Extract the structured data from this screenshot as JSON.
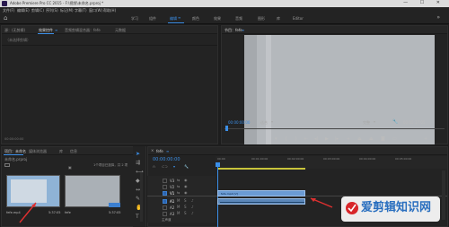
{
  "titlebar": {
    "title": "Adobe Premiere Pro CC 2015 - F:\\视频\\未命名.prproj *",
    "controls": "—  ☐  ✕"
  },
  "menu": [
    "文件(F)",
    "编辑(E)",
    "剪辑(C)",
    "序列(S)",
    "标记(M)",
    "字幕(T)",
    "窗口(W)",
    "帮助(H)"
  ],
  "workspaces": {
    "items": [
      "学习",
      "组件",
      "编辑",
      "颜色",
      "效果",
      "音频",
      "图形",
      "库"
    ],
    "active_index": 2,
    "extra": "Editor",
    "more": "»"
  },
  "source_panel": {
    "tabs": [
      "源：(无剪辑)",
      "效果控件",
      "音频剪辑混合器：fefe",
      "元数据"
    ],
    "active_tab": 1,
    "clip_label": "（未选择剪辑）",
    "timecode": "00:00:00:00"
  },
  "program_panel": {
    "tab": "节目：fefe",
    "timecode_left": "00:00:00:00",
    "fit_label": "适合",
    "quality_label": "完整",
    "timecode_right": "00:05:37:05"
  },
  "project_panel": {
    "tabs": [
      "项目：未命名",
      "媒体浏览器",
      "库",
      "信息"
    ],
    "path": "未命名.prproj",
    "item_count": "1个项目已选择，共 2 项",
    "items": [
      {
        "name": "fefe.mp4",
        "duration": "5:37:05"
      },
      {
        "name": "fefe",
        "duration": "5:37:05"
      }
    ],
    "colors": {
      "thumb1": "#8fb3d6",
      "thumb2": "#aab0b6"
    }
  },
  "timeline": {
    "tab": "fefe",
    "timecode": "00:00:00:00",
    "ruler": [
      "00:00",
      "00:01:00:00",
      "00:02:00:00",
      "00:03:00:00",
      "00:04:00:00",
      "00:05:00:00"
    ],
    "tracks": [
      {
        "name": "V3"
      },
      {
        "name": "V2"
      },
      {
        "name": "V1"
      },
      {
        "name": "A1"
      },
      {
        "name": "A2"
      },
      {
        "name": "A3"
      }
    ],
    "video_clip": "fefe.mp4 [V]",
    "master": "主声道"
  },
  "watermark": {
    "text": "爱剪辑知识网",
    "colors": {
      "bg": "#ffffff",
      "text": "#2a6fbf",
      "red": "#d8262a"
    }
  },
  "colors": {
    "accent": "#3b8fe8",
    "annotation_arrow": "#e03030"
  }
}
